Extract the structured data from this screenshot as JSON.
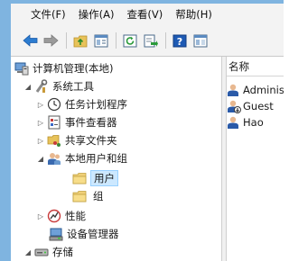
{
  "menu": {
    "file": "文件(F)",
    "action": "操作(A)",
    "view": "查看(V)",
    "help": "帮助(H)"
  },
  "toolbar": {
    "icons": [
      "back-arrow-icon",
      "forward-arrow-icon",
      "up-folder-icon",
      "show-hide-tree-icon",
      "refresh-icon",
      "export-list-icon",
      "help-icon",
      "properties-icon"
    ]
  },
  "tree": {
    "root": "计算机管理(本地)",
    "system_tools": "系统工具",
    "task_scheduler": "任务计划程序",
    "event_viewer": "事件查看器",
    "shared_folders": "共享文件夹",
    "local_users_groups": "本地用户和组",
    "users": "用户",
    "groups": "组",
    "performance": "性能",
    "device_manager": "设备管理器",
    "storage": "存储"
  },
  "list": {
    "column_name": "名称",
    "rows": [
      "Administrator",
      "Guest",
      "Hao"
    ]
  }
}
